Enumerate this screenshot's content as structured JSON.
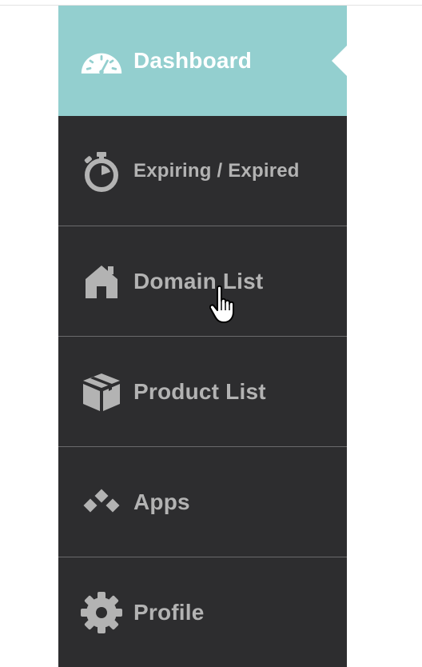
{
  "sidebar": {
    "items": [
      {
        "label": "Dashboard",
        "icon": "speedometer-icon",
        "active": true
      },
      {
        "label": "Expiring / Expired",
        "icon": "stopwatch-icon",
        "active": false
      },
      {
        "label": "Domain List",
        "icon": "house-icon",
        "active": false
      },
      {
        "label": "Product List",
        "icon": "box-icon",
        "active": false
      },
      {
        "label": "Apps",
        "icon": "diamonds-icon",
        "active": false
      },
      {
        "label": "Profile",
        "icon": "gear-icon",
        "active": false
      }
    ]
  },
  "colors": {
    "sidebar_bg": "#2d2d2f",
    "active_bg": "#93cfcf",
    "inactive_text": "#b3b3b3",
    "active_text": "#ffffff"
  }
}
